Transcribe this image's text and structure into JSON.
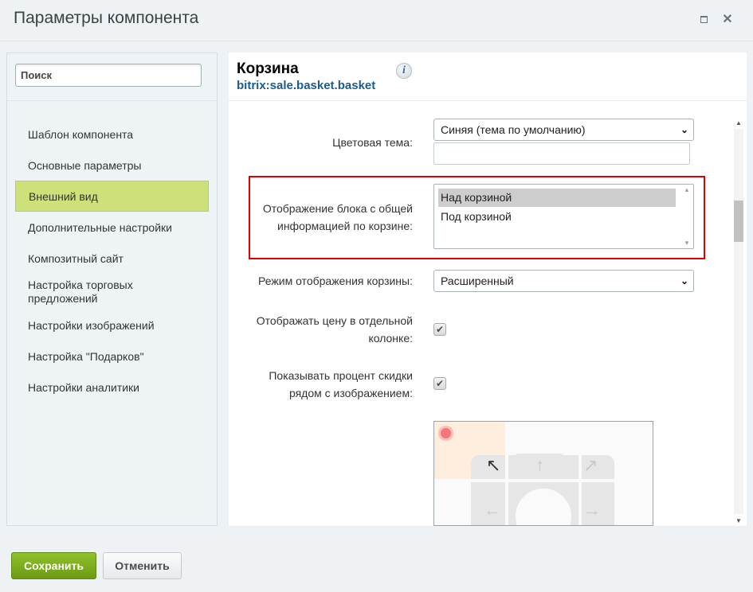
{
  "window": {
    "title": "Параметры компонента",
    "controls": {
      "maximize_icon": "maximize-icon",
      "close_icon": "close-icon",
      "close_glyph": "✕"
    }
  },
  "sidebar": {
    "search": {
      "placeholder": "Поиск",
      "value": ""
    },
    "items": [
      {
        "label": "Шаблон компонента",
        "active": false
      },
      {
        "label": "Основные параметры",
        "active": false
      },
      {
        "label": "Внешний вид",
        "active": true
      },
      {
        "label": "Дополнительные настройки",
        "active": false
      },
      {
        "label": "Композитный сайт",
        "active": false
      },
      {
        "label": "Настройка торговых предложений",
        "active": false
      },
      {
        "label": "Настройки изображений",
        "active": false
      },
      {
        "label": "Настройка \"Подарков\"",
        "active": false
      },
      {
        "label": "Настройки аналитики",
        "active": false
      }
    ]
  },
  "component": {
    "title": "Корзина",
    "code": "bitrix:sale.basket.basket",
    "info_glyph": "i"
  },
  "fields": {
    "color_theme": {
      "label": "Цветовая тема:",
      "value": "Синяя (тема по умолчанию)",
      "custom_value": ""
    },
    "total_block": {
      "label_line1": "Отображение блока с общей",
      "label_line2": "информацией по корзине:",
      "options": [
        {
          "label": "Над корзиной",
          "selected": true
        },
        {
          "label": "Под корзиной",
          "selected": false
        }
      ]
    },
    "display_mode": {
      "label": "Режим отображения корзины:",
      "value": "Расширенный"
    },
    "price_column": {
      "label_line1": "Отображать цену в отдельной",
      "label_line2": "колонке:",
      "checked": true,
      "check_glyph": "✔"
    },
    "discount_percent": {
      "label_line1": "Показывать процент скидки",
      "label_line2": "рядом с изображением:",
      "checked": true,
      "check_glyph": "✔"
    },
    "position_picker": {
      "selected_position": "top-left",
      "arrows": {
        "up_left": "↖",
        "up": "↑",
        "up_right": "↗",
        "left": "←",
        "right": "→"
      }
    }
  },
  "footer": {
    "save_label": "Сохранить",
    "cancel_label": "Отменить"
  },
  "colors": {
    "accent_active_nav": "#cde07a",
    "save_button": "#7aab1c",
    "highlight_border": "#e00000",
    "link_code": "#1a5c8c"
  }
}
